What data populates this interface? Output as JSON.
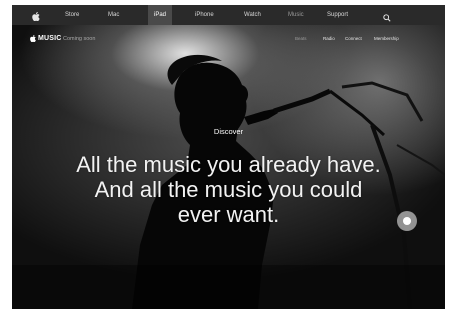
{
  "globalnav": {
    "items": [
      {
        "label": "Store"
      },
      {
        "label": "Mac"
      },
      {
        "label": "iPad"
      },
      {
        "label": "iPhone"
      },
      {
        "label": "Watch"
      },
      {
        "label": "Music"
      },
      {
        "label": "Support"
      }
    ],
    "active": "iPad",
    "icons": {
      "logo": "apple-logo-icon",
      "search": "search-icon"
    }
  },
  "subnav": {
    "brand": "MUSIC",
    "tagline": "Coming soon",
    "links": [
      {
        "label": "Beats"
      },
      {
        "label": "Radio"
      },
      {
        "label": "Connect"
      },
      {
        "label": "Membership"
      }
    ]
  },
  "hero": {
    "eyebrow": "Discover",
    "line1": "All the music you already have.",
    "line2": "And all the music you could",
    "line3": "ever want."
  },
  "colors": {
    "nav_bg": "#2a2a2a",
    "hero_bg": "#0b0b0b",
    "text": "#ffffff"
  }
}
